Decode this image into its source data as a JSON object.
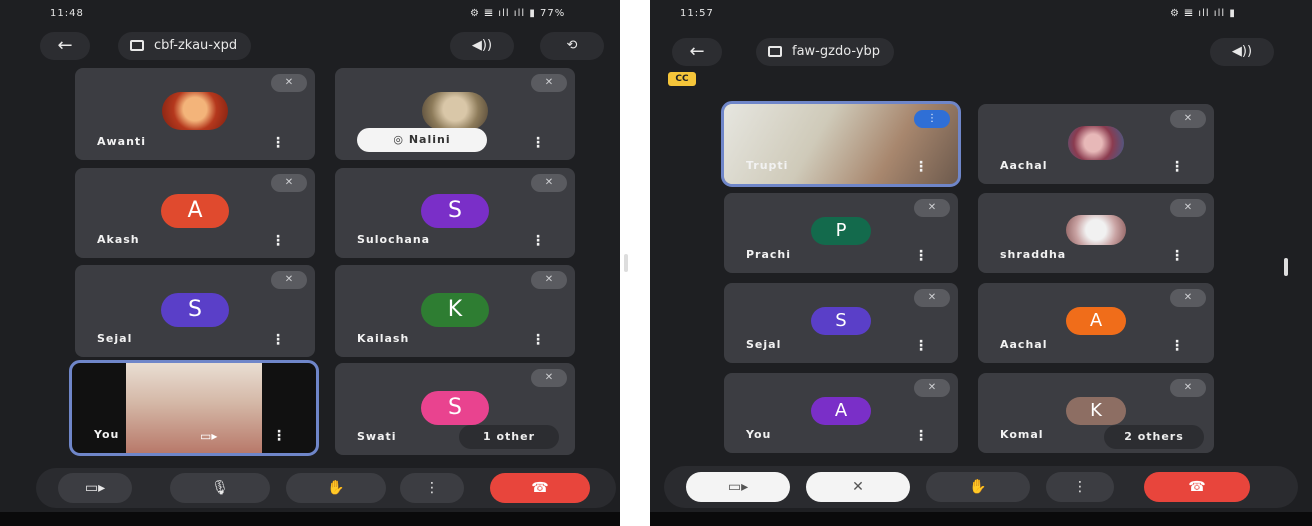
{
  "left": {
    "status": {
      "time": "11:48",
      "right": "⚙ 𝌆 ıll ıll ▮ 77%"
    },
    "meeting_code": "cbf-zkau-xpd",
    "tiles": [
      {
        "name": "Awanti"
      },
      {
        "name": "Nalini",
        "chip": "◎ Nalini"
      },
      {
        "name": "Akash",
        "initial": "A"
      },
      {
        "name": "Sulochana",
        "initial": "S"
      },
      {
        "name": "Sejal",
        "initial": "S"
      },
      {
        "name": "Kailash",
        "initial": "K"
      },
      {
        "name": "You"
      },
      {
        "name": "Swati",
        "initial": "S",
        "others": "1 other"
      }
    ]
  },
  "right": {
    "status": {
      "time": "11:57",
      "right": "⚙ 𝌆 ıll ıll ▮"
    },
    "meeting_code": "faw-gzdo-ybp",
    "badge": "CC",
    "tiles": [
      {
        "name": "Trupti"
      },
      {
        "name": "Aachal"
      },
      {
        "name": "Prachi",
        "initial": "P"
      },
      {
        "name": "shraddha"
      },
      {
        "name": "Sejal",
        "initial": "S"
      },
      {
        "name": "Aachal",
        "initial": "A"
      },
      {
        "name": "You",
        "initial": "A"
      },
      {
        "name": "Komal",
        "initial": "K",
        "others": "2 others"
      }
    ]
  },
  "icons": {
    "back": "←",
    "speaker": "◀))",
    "camera_switch": "⟲",
    "mic_off": "✕",
    "video": "▭▸",
    "mic": "🎙",
    "hand": "✋",
    "more": "⋮",
    "end_call": "☎"
  },
  "colors": {
    "avatar_red": "#e04a2e",
    "avatar_purple": "#7a2fc8",
    "avatar_indigo": "#5a3fc8",
    "avatar_green": "#2e7d32",
    "avatar_pink": "#e9438f",
    "avatar_teal": "#136a4c",
    "avatar_orange": "#f06d1a",
    "avatar_tan": "#8d6e63",
    "end_red": "#e8453c"
  }
}
